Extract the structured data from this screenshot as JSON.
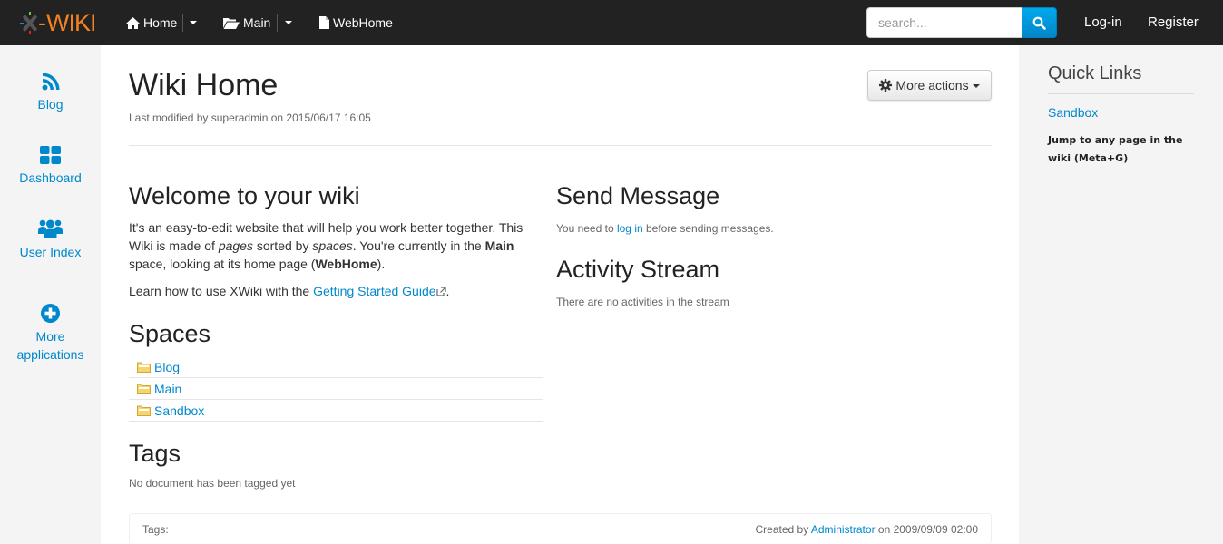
{
  "navbar": {
    "logo_text": "WIKI",
    "breadcrumbs": [
      {
        "label": "Home",
        "icon": "home-icon",
        "has_dropdown": true
      },
      {
        "label": "Main",
        "icon": "folder-open-icon",
        "has_dropdown": true
      },
      {
        "label": "WebHome",
        "icon": "file-icon",
        "has_dropdown": false
      }
    ],
    "search": {
      "placeholder": "search...",
      "value": "",
      "icon": "search-icon"
    },
    "login_label": "Log-in",
    "register_label": "Register"
  },
  "appbar": {
    "items": [
      {
        "label": "Blog",
        "icon": "rss-icon"
      },
      {
        "label": "Dashboard",
        "icon": "dashboard-grid-icon"
      },
      {
        "label": "User Index",
        "icon": "users-icon"
      },
      {
        "label_line1": "More",
        "label_line2": "applications",
        "icon": "plus-circle-icon"
      }
    ]
  },
  "page": {
    "title": "Wiki Home",
    "last_modified": "Last modified by superadmin on 2015/06/17 16:05",
    "more_actions_label": "More actions",
    "welcome": {
      "heading": "Welcome to your wiki",
      "p1_a": "It's an easy-to-edit website that will help you work better together. This Wiki is made of ",
      "p1_em1": "pages",
      "p1_b": " sorted by ",
      "p1_em2": "spaces",
      "p1_c": ". You're currently in the ",
      "p1_strong1": "Main",
      "p1_d": " space, looking at its home page (",
      "p1_strong2": "WebHome",
      "p1_e": ").",
      "p2_a": "Learn how to use XWiki with the ",
      "p2_link": "Getting Started Guide",
      "p2_b": "."
    },
    "spaces": {
      "heading": "Spaces",
      "items": [
        "Blog",
        "Main",
        "Sandbox"
      ]
    },
    "tags": {
      "heading": "Tags",
      "empty_text": "No document has been tagged yet"
    },
    "send_message": {
      "heading": "Send Message",
      "text_a": "You need to ",
      "link": "log in",
      "text_b": " before sending messages."
    },
    "activity": {
      "heading": "Activity Stream",
      "empty_text": "There are no activities in the stream"
    },
    "footer": {
      "tags_label": "Tags:",
      "created_a": "Created by ",
      "created_by": "Administrator",
      "created_b": " on 2009/09/09 02:00"
    }
  },
  "quick_links": {
    "title": "Quick Links",
    "link": "Sandbox",
    "jump_text": "Jump to any page in the wiki (Meta+G)"
  },
  "colors": {
    "navbar_bg": "#222222",
    "logo": "#f58220",
    "link": "#0088cc",
    "search_button": "#0098d6"
  }
}
